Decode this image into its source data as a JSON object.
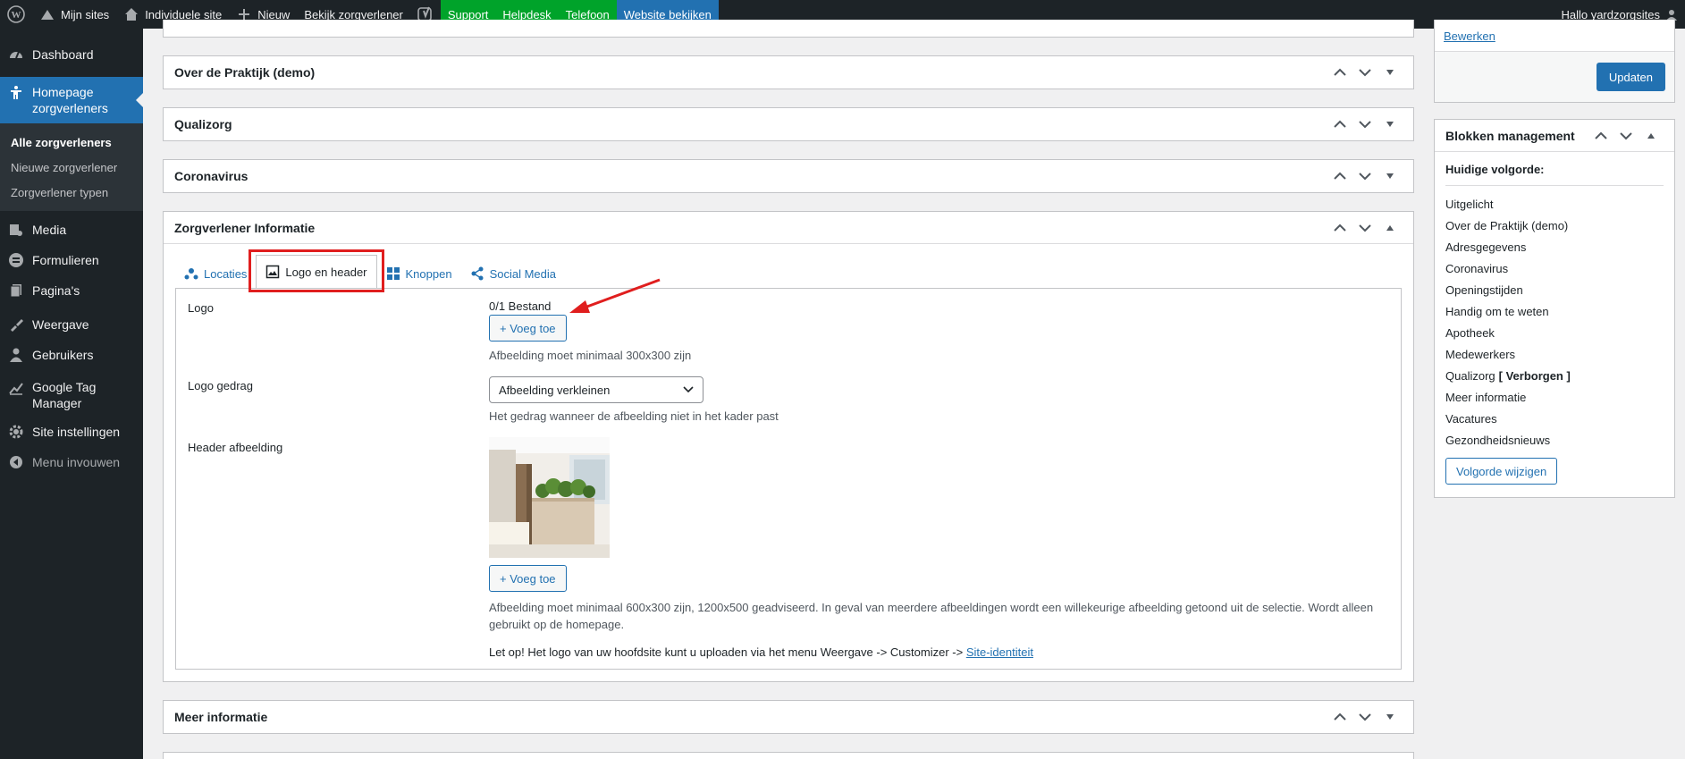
{
  "adminbar": {
    "my_sites": "Mijn sites",
    "site": "Individuele site",
    "new": "Nieuw",
    "view": "Bekijk zorgverlener",
    "support": "Support",
    "helpdesk": "Helpdesk",
    "phone": "Telefoon",
    "view_site": "Website bekijken",
    "greeting": "Hallo yardzorgsites"
  },
  "sidebar": {
    "dashboard": "Dashboard",
    "current_menu": "Homepage zorgverleners",
    "sub_all": "Alle zorgverleners",
    "sub_new": "Nieuwe zorgverlener",
    "sub_types": "Zorgverlener typen",
    "media": "Media",
    "forms": "Formulieren",
    "pages": "Pagina's",
    "appearance": "Weergave",
    "users": "Gebruikers",
    "gtm": "Google Tag Manager",
    "site_settings": "Site instellingen",
    "collapse": "Menu invouwen"
  },
  "boxes": {
    "praktijk": "Over de Praktijk (demo)",
    "qualizorg": "Qualizorg",
    "corona": "Coronavirus",
    "info": "Zorgverlener Informatie",
    "meer": "Meer informatie"
  },
  "tabs": {
    "locaties": "Locaties",
    "logo": "Logo en header",
    "knoppen": "Knoppen",
    "social": "Social Media"
  },
  "fields": {
    "logo_label": "Logo",
    "logo_count": "0/1 Bestand",
    "add_button": "+ Voeg toe",
    "logo_desc": "Afbeelding moet minimaal 300x300 zijn",
    "behaviour_label": "Logo gedrag",
    "behaviour_value": "Afbeelding verkleinen",
    "behaviour_desc": "Het gedrag wanneer de afbeelding niet in het kader past",
    "header_label": "Header afbeelding",
    "header_desc": "Afbeelding moet minimaal 600x300 zijn, 1200x500 geadviseerd. In geval van meerdere afbeeldingen wordt een willekeurige afbeelding getoond uit de selectie. Wordt alleen gebruikt op de homepage.",
    "note_text": "Let op! Het logo van uw hoofdsite kunt u uploaden via het menu Weergave -> Customizer ->",
    "note_link": "Site-identiteit"
  },
  "publish": {
    "edit_link": "Bewerken",
    "update_button": "Updaten"
  },
  "blocks": {
    "title": "Blokken management",
    "current_order": "Huidige volgorde:",
    "items": [
      "Uitgelicht",
      "Over de Praktijk (demo)",
      "Adresgegevens",
      "Coronavirus",
      "Openingstijden",
      "Handig om te weten",
      "Apotheek",
      "Medewerkers",
      "Qualizorg",
      "Meer informatie",
      "Vacatures",
      "Gezondheidsnieuws"
    ],
    "hidden_tag": "[ Verborgen ]",
    "change_button": "Volgorde wijzigen"
  },
  "colors": {
    "accent": "#2271b1",
    "admin_dark": "#1d2327",
    "support_green": "#00a32a",
    "highlight_red": "#e01e1e"
  }
}
